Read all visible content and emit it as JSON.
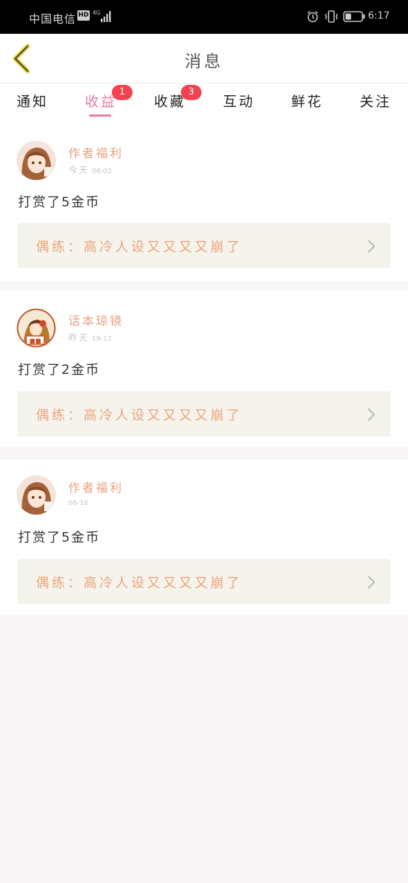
{
  "status_bar": {
    "carrier": "中国电信",
    "hd": "HD",
    "network": "4G",
    "time": "6:17"
  },
  "header": {
    "title": "消息",
    "back_icon": "chevron-left-icon"
  },
  "tabs": [
    {
      "label": "通知",
      "badge": "",
      "active": false
    },
    {
      "label": "收益",
      "badge": "1",
      "active": true
    },
    {
      "label": "收藏",
      "badge": "3",
      "active": false
    },
    {
      "label": "互动",
      "badge": "",
      "active": false
    },
    {
      "label": "鲜花",
      "badge": "",
      "active": false
    },
    {
      "label": "关注",
      "badge": "",
      "active": false
    }
  ],
  "messages": [
    {
      "sender": "作者福利",
      "day": "今天",
      "time": "06:02",
      "text": "打赏了5金币",
      "work": "偶练：高冷人设又又又又崩了"
    },
    {
      "sender": "话本琼镜",
      "day": "昨天",
      "time": "19:12",
      "text": "打赏了2金币",
      "work": "偶练：高冷人设又又又又崩了"
    },
    {
      "sender": "作者福利",
      "day": "",
      "time": "06-16",
      "text": "打赏了5金币",
      "work": "偶练：高冷人设又又又又崩了"
    }
  ],
  "colors": {
    "accent": "#e27aa4",
    "badge": "#f2424f",
    "sender": "#e9a07e",
    "work_link_bg": "#f4f4ec"
  }
}
